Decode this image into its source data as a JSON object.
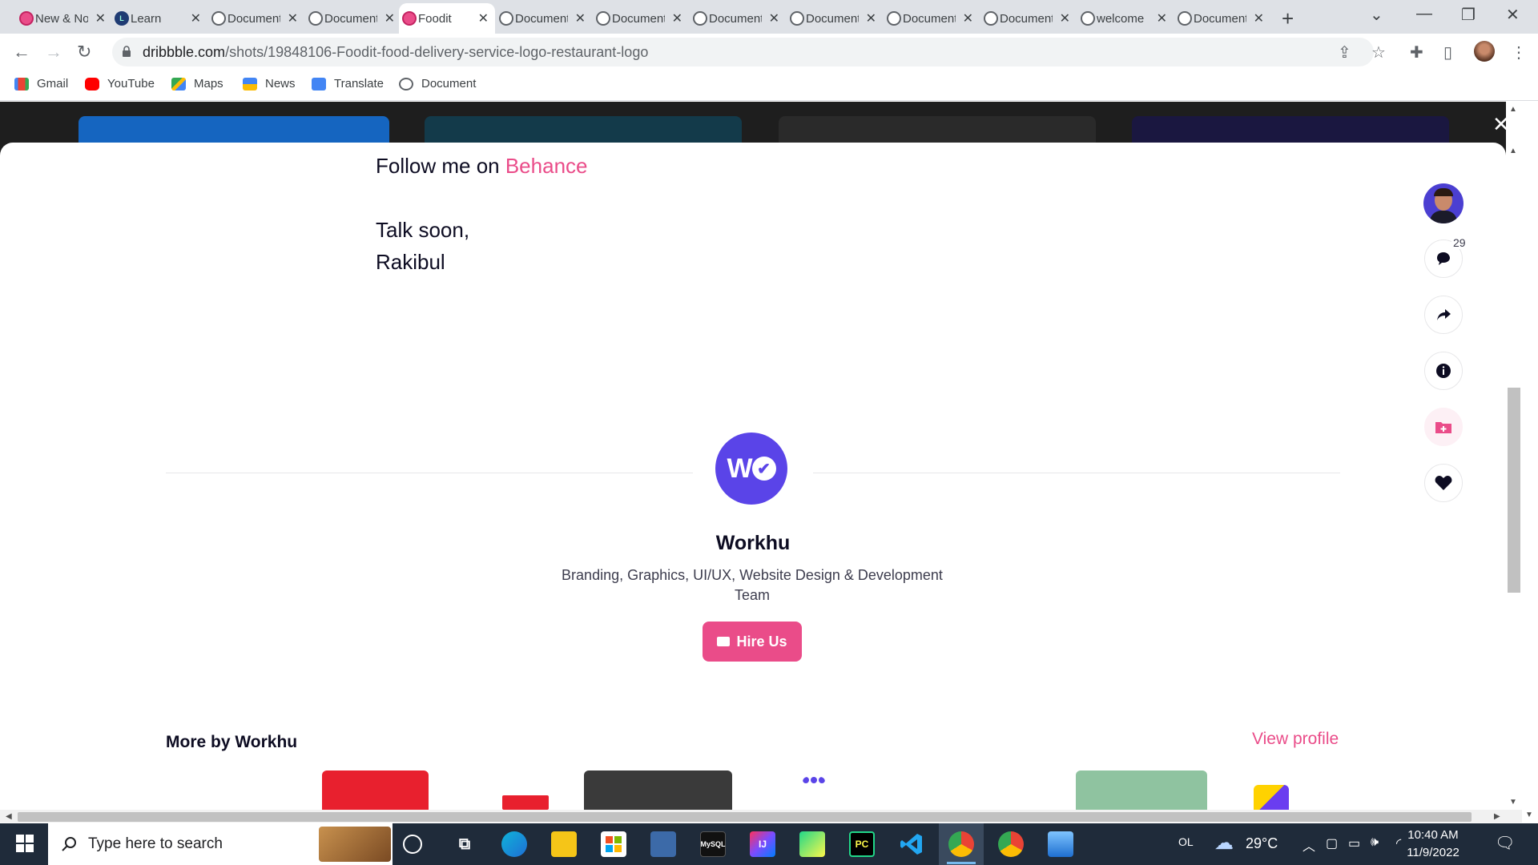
{
  "browser": {
    "tabs": [
      {
        "title": "New & Noteworthy",
        "icon": "dribbble-icon"
      },
      {
        "title": "Learn",
        "icon": "learn-icon"
      },
      {
        "title": "Document",
        "icon": "globe-icon"
      },
      {
        "title": "Document",
        "icon": "globe-icon"
      },
      {
        "title": "Foodit",
        "icon": "dribbble-icon",
        "active": true
      },
      {
        "title": "Document",
        "icon": "globe-icon"
      },
      {
        "title": "Document",
        "icon": "globe-icon"
      },
      {
        "title": "Document",
        "icon": "globe-icon"
      },
      {
        "title": "Document",
        "icon": "globe-icon"
      },
      {
        "title": "Document",
        "icon": "globe-icon"
      },
      {
        "title": "Document",
        "icon": "globe-icon"
      },
      {
        "title": "welcome",
        "icon": "globe-icon"
      },
      {
        "title": "Document",
        "icon": "globe-icon"
      }
    ],
    "url_host": "dribbble.com",
    "url_path": "/shots/19848106-Foodit-food-delivery-service-logo-restaurant-logo",
    "bookmarks": [
      {
        "label": "Gmail",
        "icon": "gmail-icon"
      },
      {
        "label": "YouTube",
        "icon": "youtube-icon"
      },
      {
        "label": "Maps",
        "icon": "maps-icon"
      },
      {
        "label": "News",
        "icon": "news-icon"
      },
      {
        "label": "Translate",
        "icon": "translate-icon"
      },
      {
        "label": "Document",
        "icon": "globe-icon"
      }
    ]
  },
  "shot": {
    "follow_prefix": "Follow me on ",
    "follow_link": "Behance",
    "signoff": "Talk soon,",
    "author": "Rakibul",
    "comment_count": "29"
  },
  "team": {
    "name": "Workhu",
    "description": "Branding, Graphics, UI/UX, Website Design & Development Team",
    "hire_label": "Hire Us",
    "more_title": "More by Workhu",
    "view_profile": "View profile"
  },
  "taskbar": {
    "search_placeholder": "Type here to search",
    "tray_label": "OL",
    "temperature": "29°C",
    "time": "10:40 AM",
    "date": "11/9/2022"
  },
  "colors": {
    "accent": "#ea4c89",
    "workhu_purple": "#5a44e8",
    "text_dark": "#0d0c22"
  }
}
